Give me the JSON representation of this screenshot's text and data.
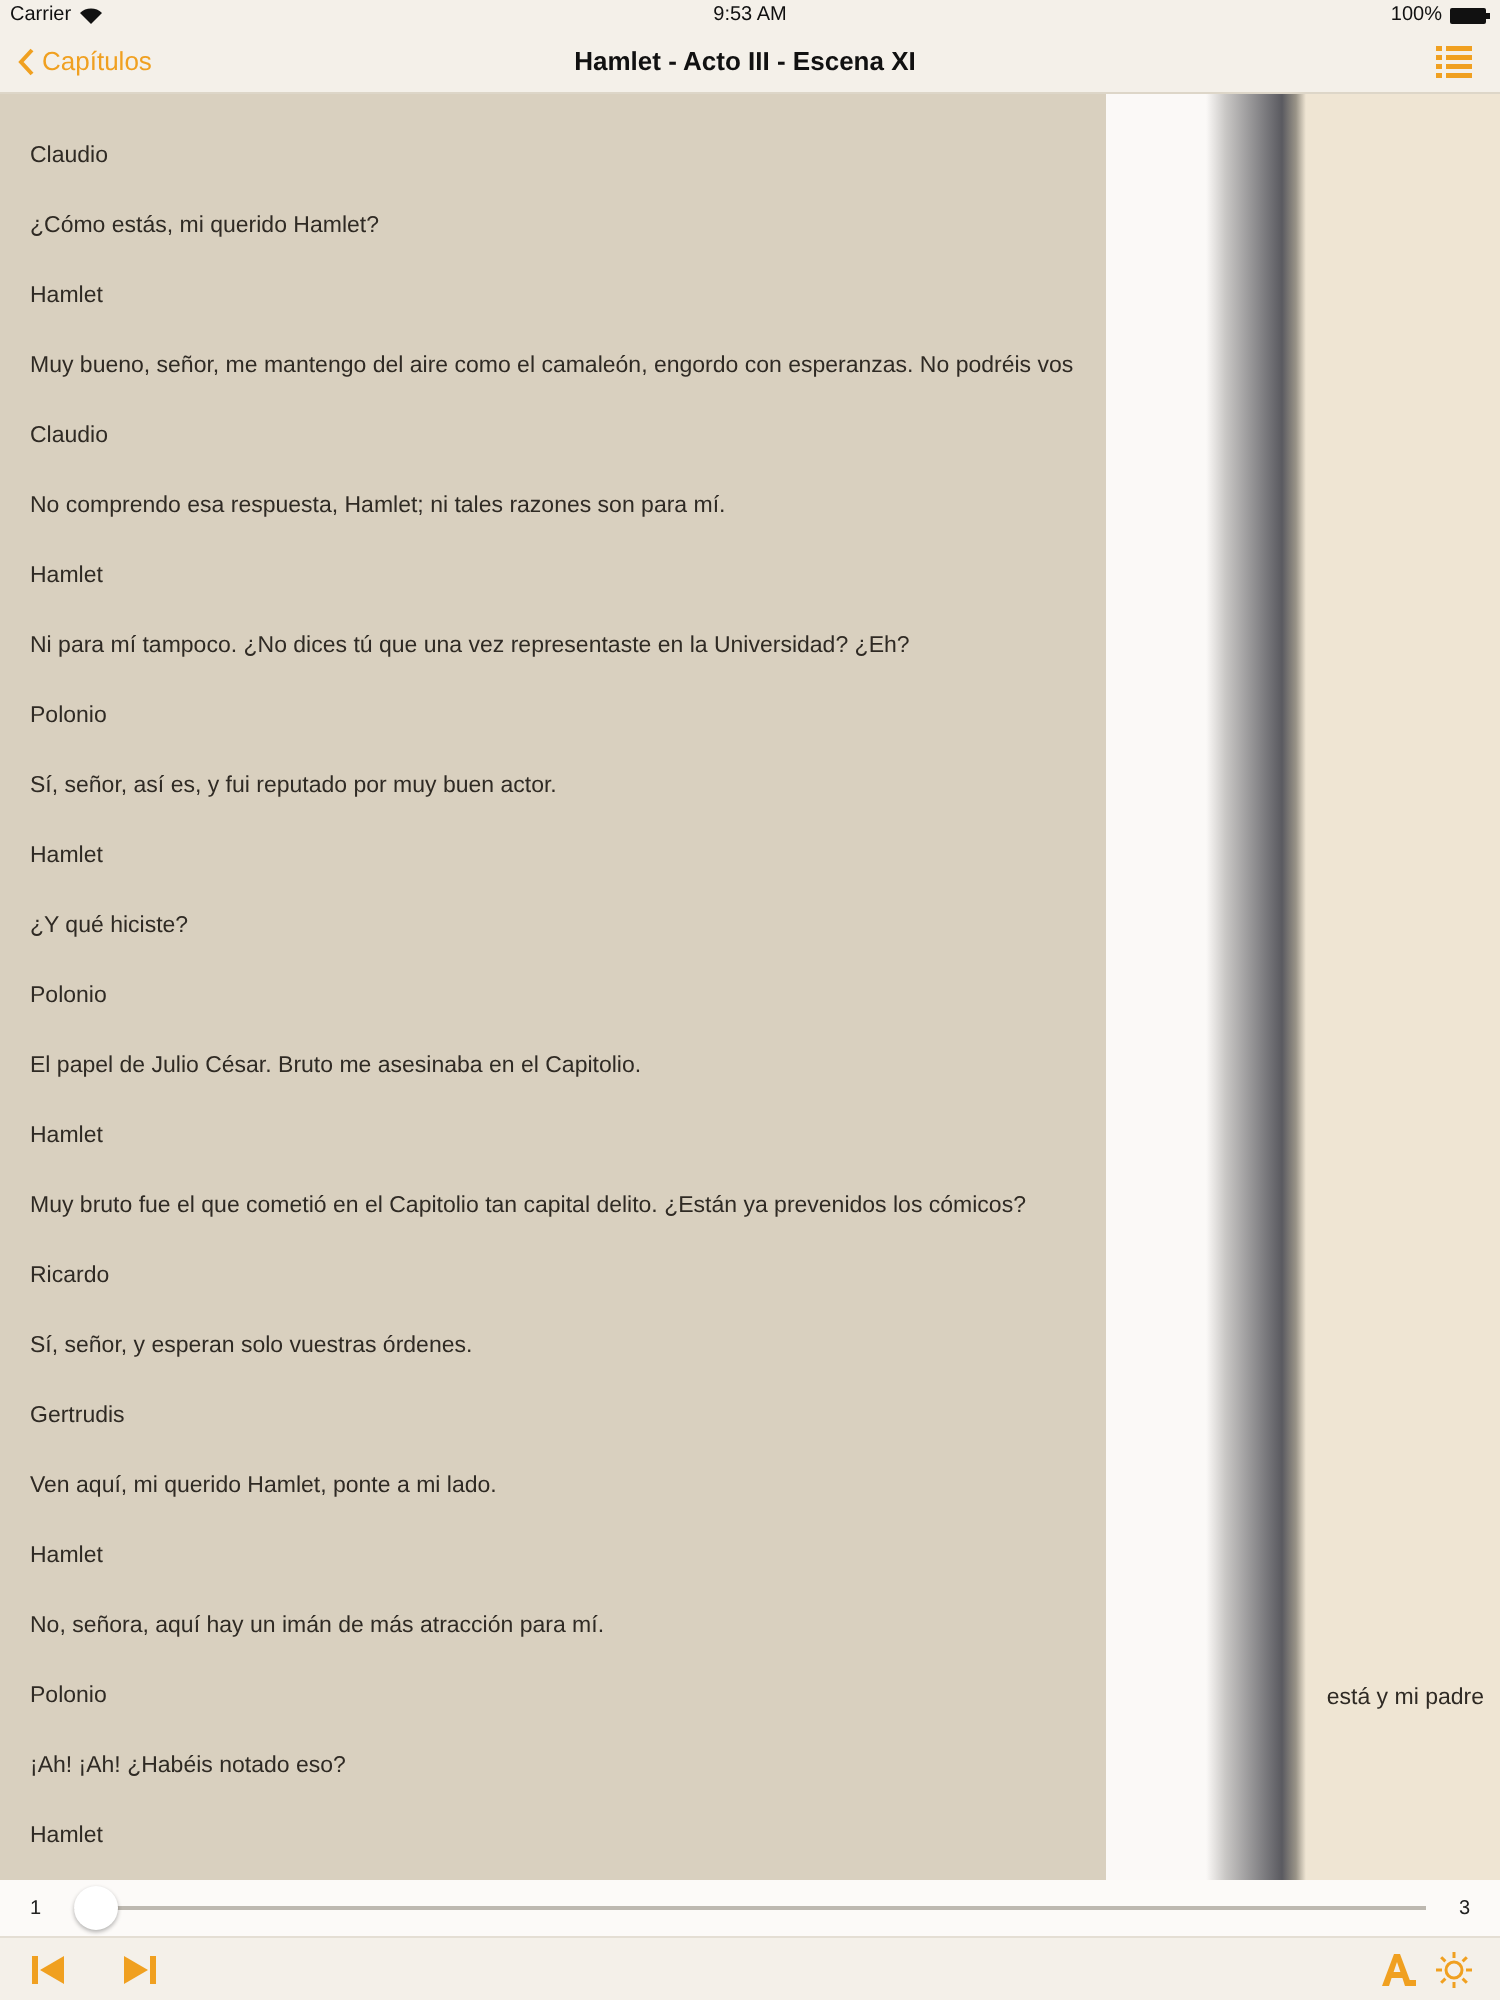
{
  "status_bar": {
    "carrier": "Carrier",
    "time": "9:53 AM",
    "battery": "100%"
  },
  "nav_bar": {
    "back": "Capítulos",
    "title": "Hamlet - Acto III - Escena XI"
  },
  "page": {
    "lines": [
      "Claudio",
      "¿Cómo estás, mi querido Hamlet?",
      "Hamlet",
      "Muy bueno, señor, me mantengo del aire como el camaleón, engordo con esperanzas. No podréis vos",
      "Claudio",
      "No comprendo esa respuesta, Hamlet; ni tales razones son para mí.",
      "Hamlet",
      "Ni para mí tampoco. ¿No dices tú que una vez representaste en la Universidad? ¿Eh?",
      "Polonio",
      "Sí, señor, así es, y fui reputado por muy buen actor.",
      "Hamlet",
      "¿Y qué hiciste?",
      "Polonio",
      "El papel de Julio César. Bruto me asesinaba en el Capitolio.",
      "Hamlet",
      "Muy bruto fue el que cometió en el Capitolio tan capital delito. ¿Están ya prevenidos los cómicos?",
      "Ricardo",
      "Sí, señor, y esperan solo vuestras órdenes.",
      "Gertrudis",
      "Ven aquí, mi querido Hamlet, ponte a mi lado.",
      "Hamlet",
      "No, señora, aquí hay un imán de más atracción para mí.",
      "Polonio",
      "¡Ah! ¡Ah! ¿Habéis notado eso?",
      "Hamlet"
    ]
  },
  "next_page": {
    "text": "está y mi padre"
  },
  "slider": {
    "min_label": "1",
    "max_label": "3",
    "level": 0
  }
}
